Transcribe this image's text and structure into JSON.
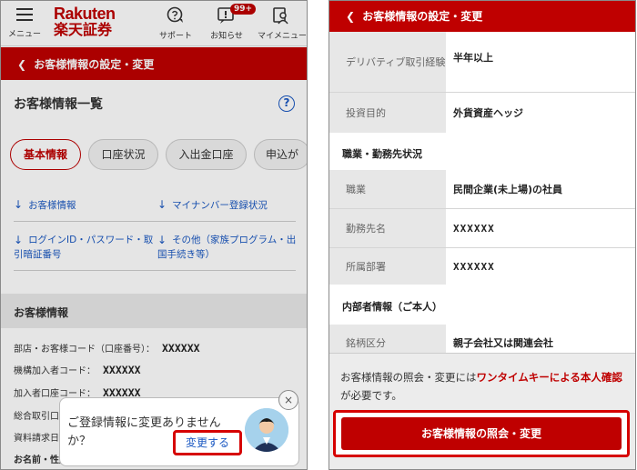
{
  "left": {
    "header": {
      "menu_label": "メニュー",
      "logo_en": "Rakuten",
      "logo_ja": "楽天証券",
      "support_label": "サポート",
      "notice_label": "お知らせ",
      "notice_badge": "99+",
      "mymenu_label": "マイメニュー"
    },
    "nav_bar_title": "お客様情報の設定・変更",
    "section_title": "お客様情報一覧",
    "help_icon_text": "?",
    "tabs": [
      {
        "label": "基本情報",
        "active": true
      },
      {
        "label": "口座状況",
        "active": false
      },
      {
        "label": "入出金口座",
        "active": false
      },
      {
        "label": "申込が",
        "active": false
      }
    ],
    "links": [
      {
        "label": "お客様情報"
      },
      {
        "label": "マイナンバー登録状況"
      },
      {
        "label": "ログインID・パスワード・取引暗証番号"
      },
      {
        "label": "その他（家族プログラム・出国手続き等）"
      }
    ],
    "info_heading": "お客様情報",
    "info_rows": [
      {
        "label": "部店・お客様コード（口座番号）：",
        "value": "XXXXXX"
      },
      {
        "label": "機構加入者コード：",
        "value": "XXXXXX"
      },
      {
        "label": "加入者口座コード：",
        "value": "XXXXXX"
      },
      {
        "label": "総合取引口",
        "value": ""
      },
      {
        "label": "資料請求日",
        "value": ""
      },
      {
        "label": "お名前・性別",
        "value": ""
      }
    ],
    "popup": {
      "message": "ご登録情報に変更ありませんか？",
      "button_label": "変更する",
      "close_symbol": "×"
    }
  },
  "right": {
    "nav_bar_title": "お客様情報の設定・変更",
    "rows_top": [
      {
        "label": "デリバティブ取引経験",
        "value": "半年以上"
      },
      {
        "label": "投資目的",
        "value": "外貨資産ヘッジ"
      }
    ],
    "section_job": "職業・勤務先状況",
    "rows_job": [
      {
        "label": "職業",
        "value": "民間企業(未上場)の社員"
      },
      {
        "label": "勤務先名",
        "value": "XXXXXX"
      },
      {
        "label": "所属部署",
        "value": "XXXXXX"
      }
    ],
    "section_insider": "内部者情報（ご本人）",
    "rows_insider": [
      {
        "label": "銘柄区分",
        "value": "親子会社又は関連会社"
      }
    ],
    "footer_note_pre": "お客様情報の照会・変更には",
    "footer_note_highlight": "ワンタイムキーによる本人確認",
    "footer_note_post": "が必要です。",
    "cta_label": "お客様情報の照会・変更"
  }
}
